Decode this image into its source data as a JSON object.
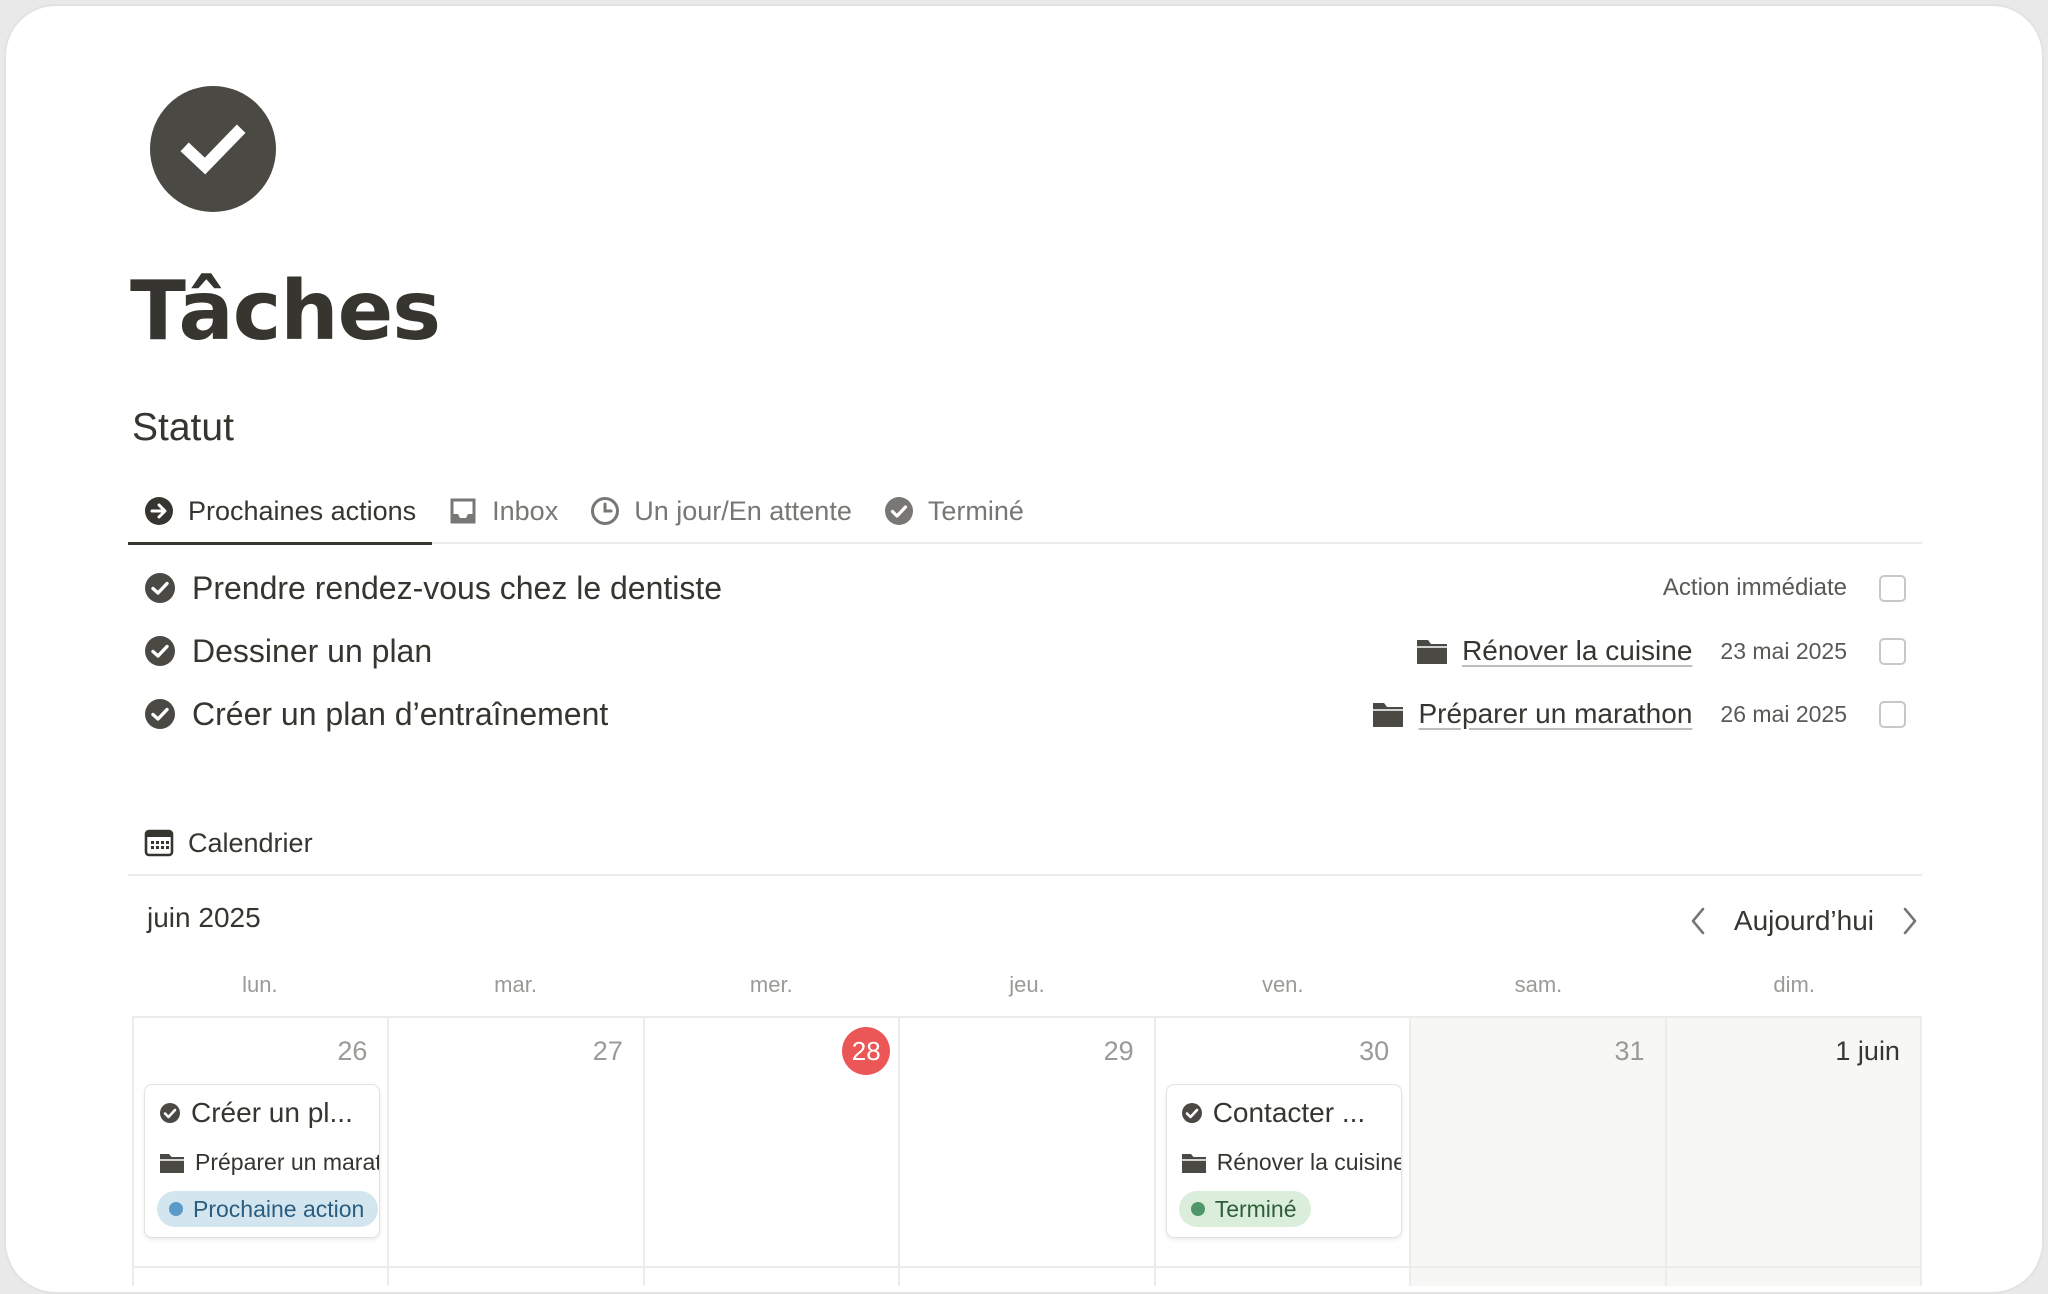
{
  "page": {
    "title": "Tâches",
    "icon": "check-circle-icon"
  },
  "status_section": {
    "title": "Statut",
    "tabs": [
      {
        "label": "Prochaines actions",
        "icon": "arrow-right-circle-icon",
        "active": true
      },
      {
        "label": "Inbox",
        "icon": "inbox-tray-icon",
        "active": false
      },
      {
        "label": "Un jour/En attente",
        "icon": "clock-icon",
        "active": false
      },
      {
        "label": "Terminé",
        "icon": "check-circle-icon",
        "active": false
      }
    ]
  },
  "tasks": [
    {
      "title": "Prendre rendez-vous chez le dentiste",
      "label": "Action immédiate",
      "project": "",
      "date": "",
      "checked": false
    },
    {
      "title": "Dessiner un plan",
      "label": "",
      "project": "Rénover la cuisine",
      "date": "23 mai 2025",
      "checked": false
    },
    {
      "title": "Créer un plan d’entraînement",
      "label": "",
      "project": "Préparer un marathon",
      "date": "26 mai 2025",
      "checked": false
    }
  ],
  "calendar": {
    "view_label": "Calendrier",
    "view_icon": "calendar-icon",
    "month_label": "juin 2025",
    "today_label": "Aujourd’hui",
    "weekdays": [
      "lun.",
      "mar.",
      "mer.",
      "jeu.",
      "ven.",
      "sam.",
      "dim."
    ],
    "days": [
      {
        "label": "26",
        "today": false,
        "weekend": false
      },
      {
        "label": "27",
        "today": false,
        "weekend": false
      },
      {
        "label": "28",
        "today": true,
        "weekend": false
      },
      {
        "label": "29",
        "today": false,
        "weekend": false
      },
      {
        "label": "30",
        "today": false,
        "weekend": false
      },
      {
        "label": "31",
        "today": false,
        "weekend": true
      },
      {
        "label": "1 juin",
        "today": false,
        "weekend": true
      }
    ],
    "events": [
      {
        "title": "Créer un pl...",
        "project": "Préparer un marathon",
        "status": "Prochaine action",
        "pill_bg": "#d3e5ef",
        "dot": "#5a9bc9",
        "text": "#2a5d80"
      },
      {
        "title": "Contacter ...",
        "project": "Rénover la cuisine",
        "status": "Terminé",
        "pill_bg": "#dbeddb",
        "dot": "#4f9768",
        "text": "#2d5d3a"
      }
    ]
  },
  "colors": {
    "text": "#37352f",
    "muted": "#9b9a97",
    "today_red": "#eb5757",
    "icon_dark": "#4a4944"
  }
}
